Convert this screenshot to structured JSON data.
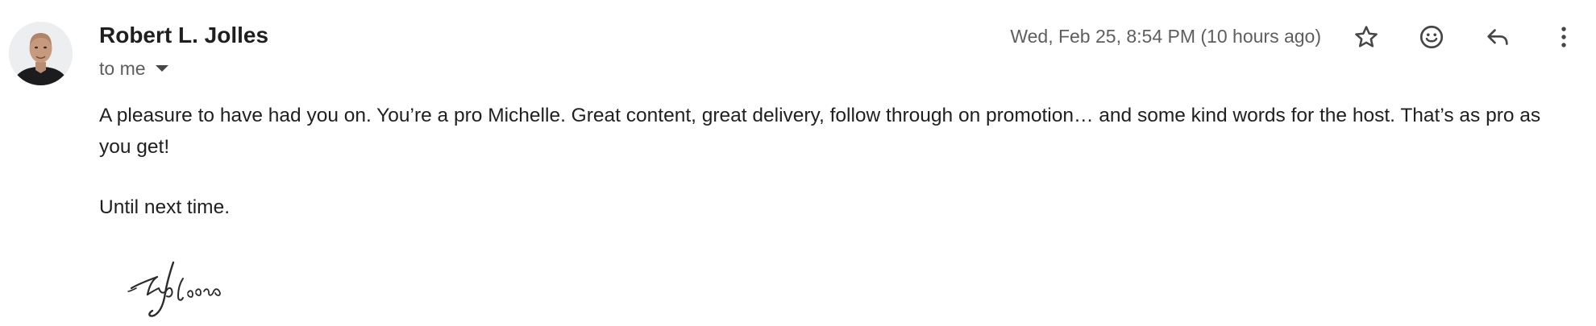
{
  "message": {
    "sender_name": "Robert L. Jolles",
    "recipient": "to me",
    "date": "Wed, Feb 25, 8:54 PM (10 hours ago)",
    "body": "A pleasure to have had you on.  You’re a pro Michelle.  Great content, great delivery, follow through on promotion… and some kind words for the host.  That’s as pro as you get!",
    "closing": "Until next time.",
    "signature_text": "Rob Jolles"
  },
  "icons": {
    "avatar": "avatar-photo",
    "star": "star-icon",
    "emoji": "emoji-icon",
    "reply": "reply-icon",
    "more": "more-vert-icon",
    "recipient_caret": "chevron-down-icon"
  },
  "colors": {
    "text_primary": "#1f1f1f",
    "text_secondary": "#5e5e5e",
    "icon": "#444746"
  }
}
